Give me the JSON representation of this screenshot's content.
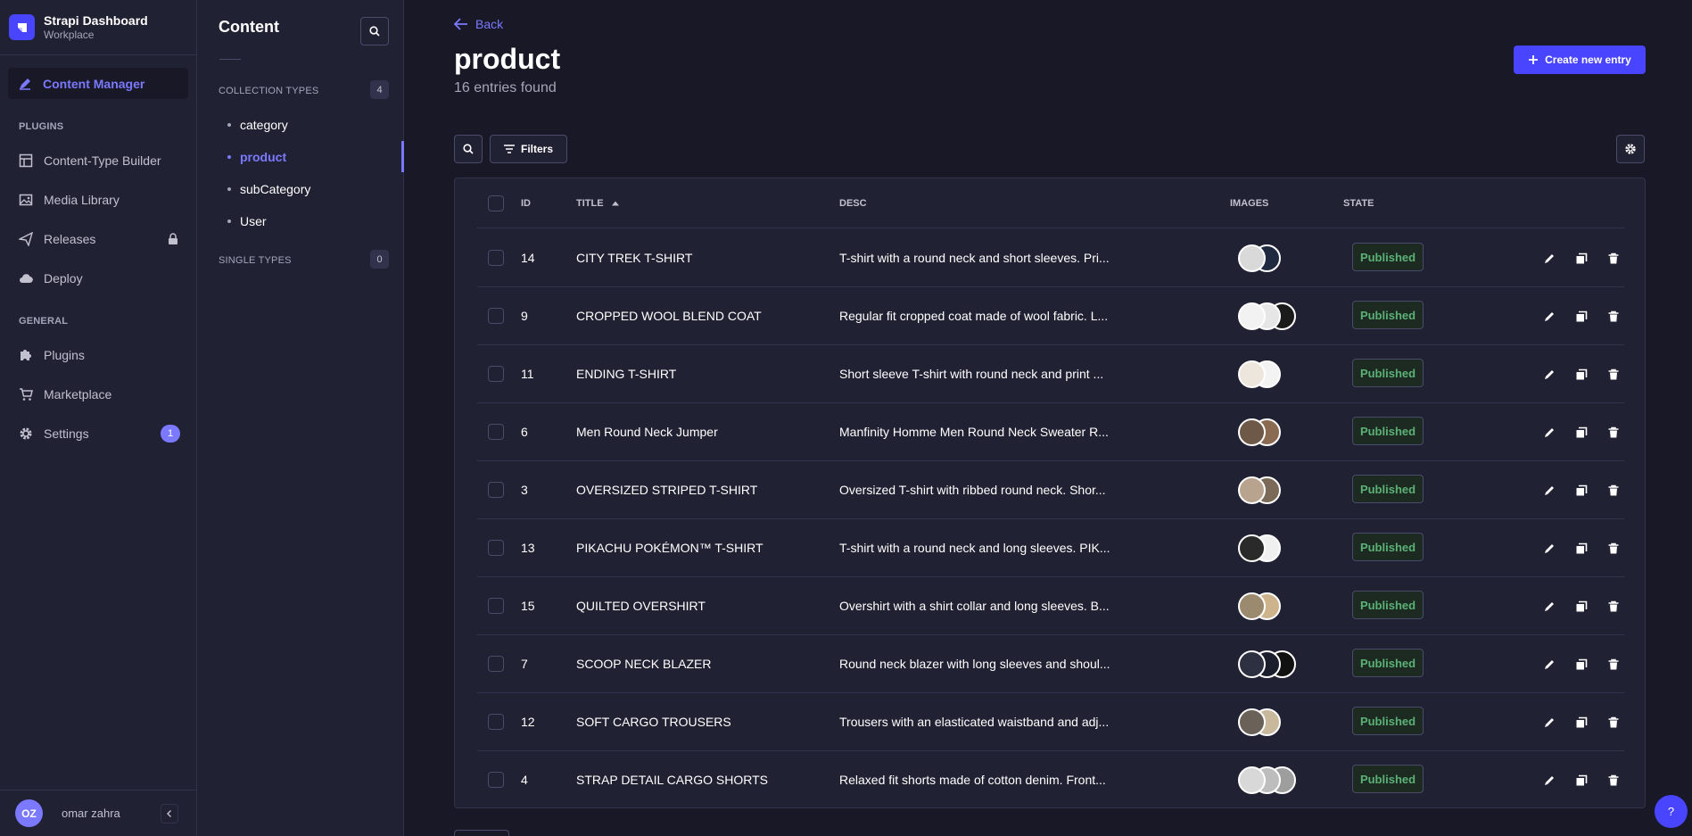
{
  "brand": {
    "title": "Strapi Dashboard",
    "subtitle": "Workplace"
  },
  "mainnav": {
    "active_label": "Content Manager",
    "plugins_heading": "PLUGINS",
    "general_heading": "GENERAL",
    "plugins": [
      {
        "label": "Content-Type Builder",
        "icon": "layout-icon"
      },
      {
        "label": "Media Library",
        "icon": "image-icon"
      },
      {
        "label": "Releases",
        "icon": "paper-plane-icon"
      },
      {
        "label": "Deploy",
        "icon": "cloud-icon"
      }
    ],
    "general": [
      {
        "label": "Plugins",
        "icon": "puzzle-icon"
      },
      {
        "label": "Marketplace",
        "icon": "cart-icon"
      },
      {
        "label": "Settings",
        "icon": "gear-icon"
      }
    ],
    "settings_badge": "1",
    "user": {
      "initials": "OZ",
      "name": "omar zahra"
    }
  },
  "subnav": {
    "title": "Content",
    "collection_heading": "COLLECTION TYPES",
    "collection_count": "4",
    "collection_items": [
      "category",
      "product",
      "subCategory",
      "User"
    ],
    "active_item": "product",
    "single_heading": "SINGLE TYPES",
    "single_count": "0"
  },
  "header": {
    "back_label": "Back",
    "title": "product",
    "subtitle": "16 entries found",
    "create_label": "Create new entry",
    "filters_label": "Filters"
  },
  "table": {
    "columns": {
      "id": "ID",
      "title": "TITLE",
      "desc": "DESC",
      "images": "IMAGES",
      "state": "STATE"
    },
    "rows": [
      {
        "id": "14",
        "title": "CITY TREK T-SHIRT",
        "desc": "T-shirt with a round neck and short sleeves. Pri...",
        "state": "Published",
        "thumbs": [
          "#d9d9d9",
          "#1f2a40"
        ]
      },
      {
        "id": "9",
        "title": "CROPPED WOOL BLEND COAT",
        "desc": "Regular fit cropped coat made of wool fabric. L...",
        "state": "Published",
        "thumbs": [
          "#f2f2f2",
          "#e6e6e6",
          "#1a1a1a"
        ]
      },
      {
        "id": "11",
        "title": "ENDING T-SHIRT",
        "desc": "Short sleeve T-shirt with round neck and print ...",
        "state": "Published",
        "thumbs": [
          "#ece6dc",
          "#f3f3f3"
        ]
      },
      {
        "id": "6",
        "title": "Men Round Neck Jumper",
        "desc": "Manfinity Homme Men Round Neck Sweater R...",
        "state": "Published",
        "thumbs": [
          "#6e5848",
          "#8a6b52"
        ]
      },
      {
        "id": "3",
        "title": "OVERSIZED STRIPED T-SHIRT",
        "desc": "Oversized T-shirt with ribbed round neck. Shor...",
        "state": "Published",
        "thumbs": [
          "#b8a48e",
          "#7b6a58"
        ]
      },
      {
        "id": "13",
        "title": "PIKACHU POKÉMON™ T-SHIRT",
        "desc": "T-shirt with a round neck and long sleeves. PIK...",
        "state": "Published",
        "thumbs": [
          "#2a2a2a",
          "#f0f0f0"
        ]
      },
      {
        "id": "15",
        "title": "QUILTED OVERSHIRT",
        "desc": "Overshirt with a shirt collar and long sleeves. B...",
        "state": "Published",
        "thumbs": [
          "#9c8a6e",
          "#cdb48c"
        ]
      },
      {
        "id": "7",
        "title": "SCOOP NECK BLAZER",
        "desc": "Round neck blazer with long sleeves and shoul...",
        "state": "Published",
        "thumbs": [
          "#2c3040",
          "#1a1d2c",
          "#111111"
        ]
      },
      {
        "id": "12",
        "title": "SOFT CARGO TROUSERS",
        "desc": "Trousers with an elasticated waistband and adj...",
        "state": "Published",
        "thumbs": [
          "#6a6258",
          "#c9b99c"
        ]
      },
      {
        "id": "4",
        "title": "STRAP DETAIL CARGO SHORTS",
        "desc": "Relaxed fit shorts made of cotton denim. Front...",
        "state": "Published",
        "thumbs": [
          "#d8d8d8",
          "#bdbdbd",
          "#9e9e9e"
        ]
      }
    ]
  },
  "help_label": "?",
  "colors": {
    "accent": "#7b79ff",
    "primary": "#4945ff",
    "published": "#5cb176",
    "bg": "#181826",
    "panel": "#212134"
  }
}
